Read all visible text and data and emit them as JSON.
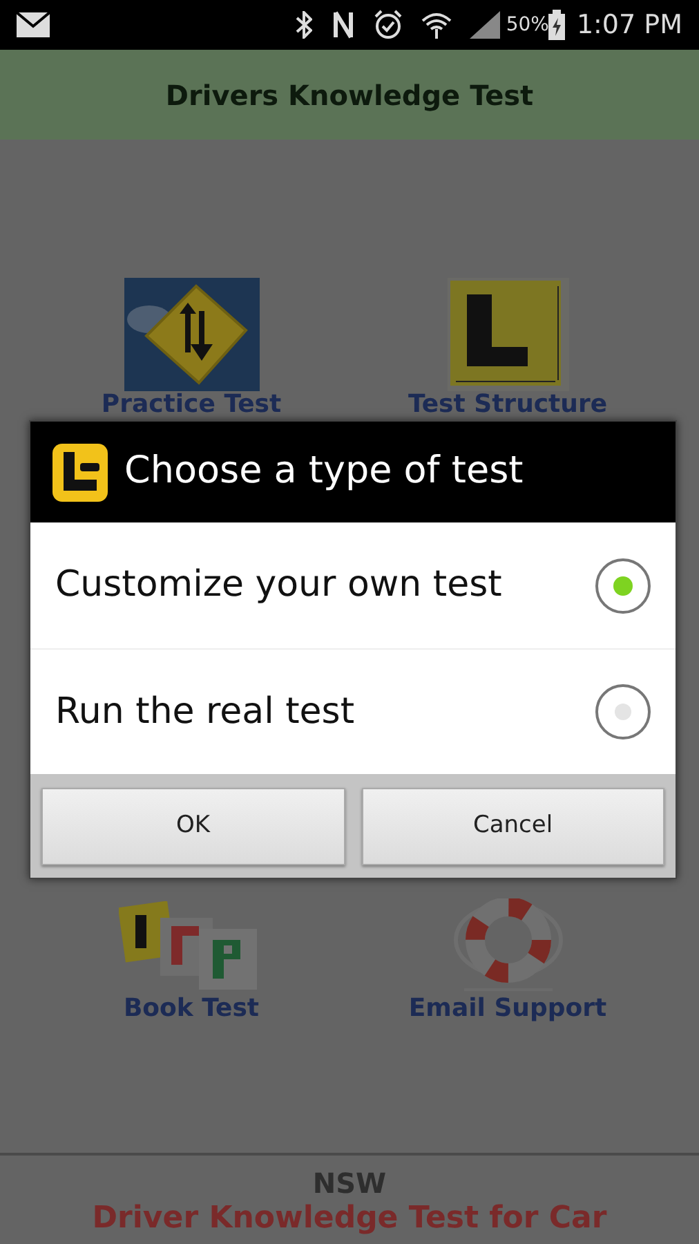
{
  "status_bar": {
    "battery": "50%",
    "time": "1:07 PM"
  },
  "header": {
    "title": "Drivers Knowledge Test"
  },
  "menu": [
    {
      "label": "Practice Test",
      "kind": "sign"
    },
    {
      "label": "Test Structure",
      "kind": "lplate"
    },
    {
      "label": "Book Test",
      "kind": "plates"
    },
    {
      "label": "Email Support",
      "kind": "lifebuoy"
    }
  ],
  "footer": {
    "state": "NSW",
    "subtitle": "Driver Knowledge Test for Car"
  },
  "dialog": {
    "title": "Choose a type of test",
    "options": [
      {
        "label": "Customize your own test",
        "selected": true
      },
      {
        "label": "Run the real test",
        "selected": false
      }
    ],
    "buttons": [
      "OK",
      "Cancel"
    ]
  }
}
